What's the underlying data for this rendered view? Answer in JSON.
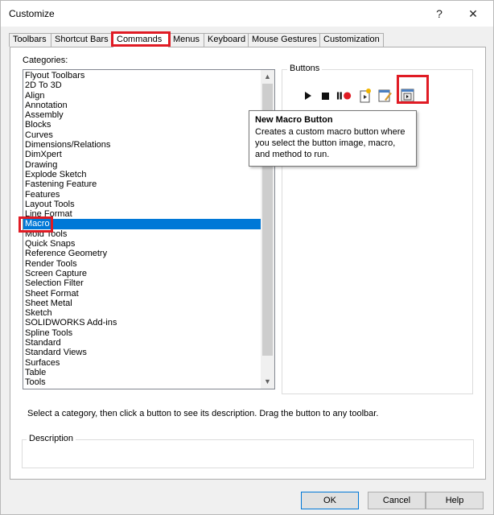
{
  "window": {
    "title": "Customize",
    "help_glyph": "?",
    "close_glyph": "✕"
  },
  "tabs": [
    {
      "label": "Toolbars"
    },
    {
      "label": "Shortcut Bars"
    },
    {
      "label": "Commands"
    },
    {
      "label": "Menus"
    },
    {
      "label": "Keyboard"
    },
    {
      "label": "Mouse Gestures"
    },
    {
      "label": "Customization"
    }
  ],
  "active_tab": "Commands",
  "categories": {
    "label": "Categories:",
    "selected": "Macro",
    "items": [
      "Flyout Toolbars",
      "2D To 3D",
      "Align",
      "Annotation",
      "Assembly",
      "Blocks",
      "Curves",
      "Dimensions/Relations",
      "DimXpert",
      "Drawing",
      "Explode Sketch",
      "Fastening Feature",
      "Features",
      "Layout Tools",
      "Line Format",
      "Macro",
      "Mold Tools",
      "Quick Snaps",
      "Reference Geometry",
      "Render Tools",
      "Screen Capture",
      "Selection Filter",
      "Sheet Format",
      "Sheet Metal",
      "Sketch",
      "SOLIDWORKS Add-ins",
      "Spline Tools",
      "Standard",
      "Standard Views",
      "Surfaces",
      "Table",
      "Tools"
    ]
  },
  "buttons_group": {
    "label": "Buttons",
    "icons": [
      "run-macro-icon",
      "stop-macro-icon",
      "pause-record-macro-icon",
      "new-macro-icon",
      "edit-macro-icon",
      "customize-macro-icon",
      "new-macro-button-icon"
    ]
  },
  "tooltip": {
    "title": "New Macro Button",
    "body": "Creates a custom macro button where you select the button image, macro, and method to run."
  },
  "instruction": "Select a category, then click a button to see its description. Drag the button to any toolbar.",
  "description": {
    "label": "Description"
  },
  "footer": {
    "ok_label": "OK",
    "cancel_label": "Cancel",
    "help_label": "Help"
  },
  "colors": {
    "selection": "#0078d7",
    "highlight": "#e01b24"
  }
}
